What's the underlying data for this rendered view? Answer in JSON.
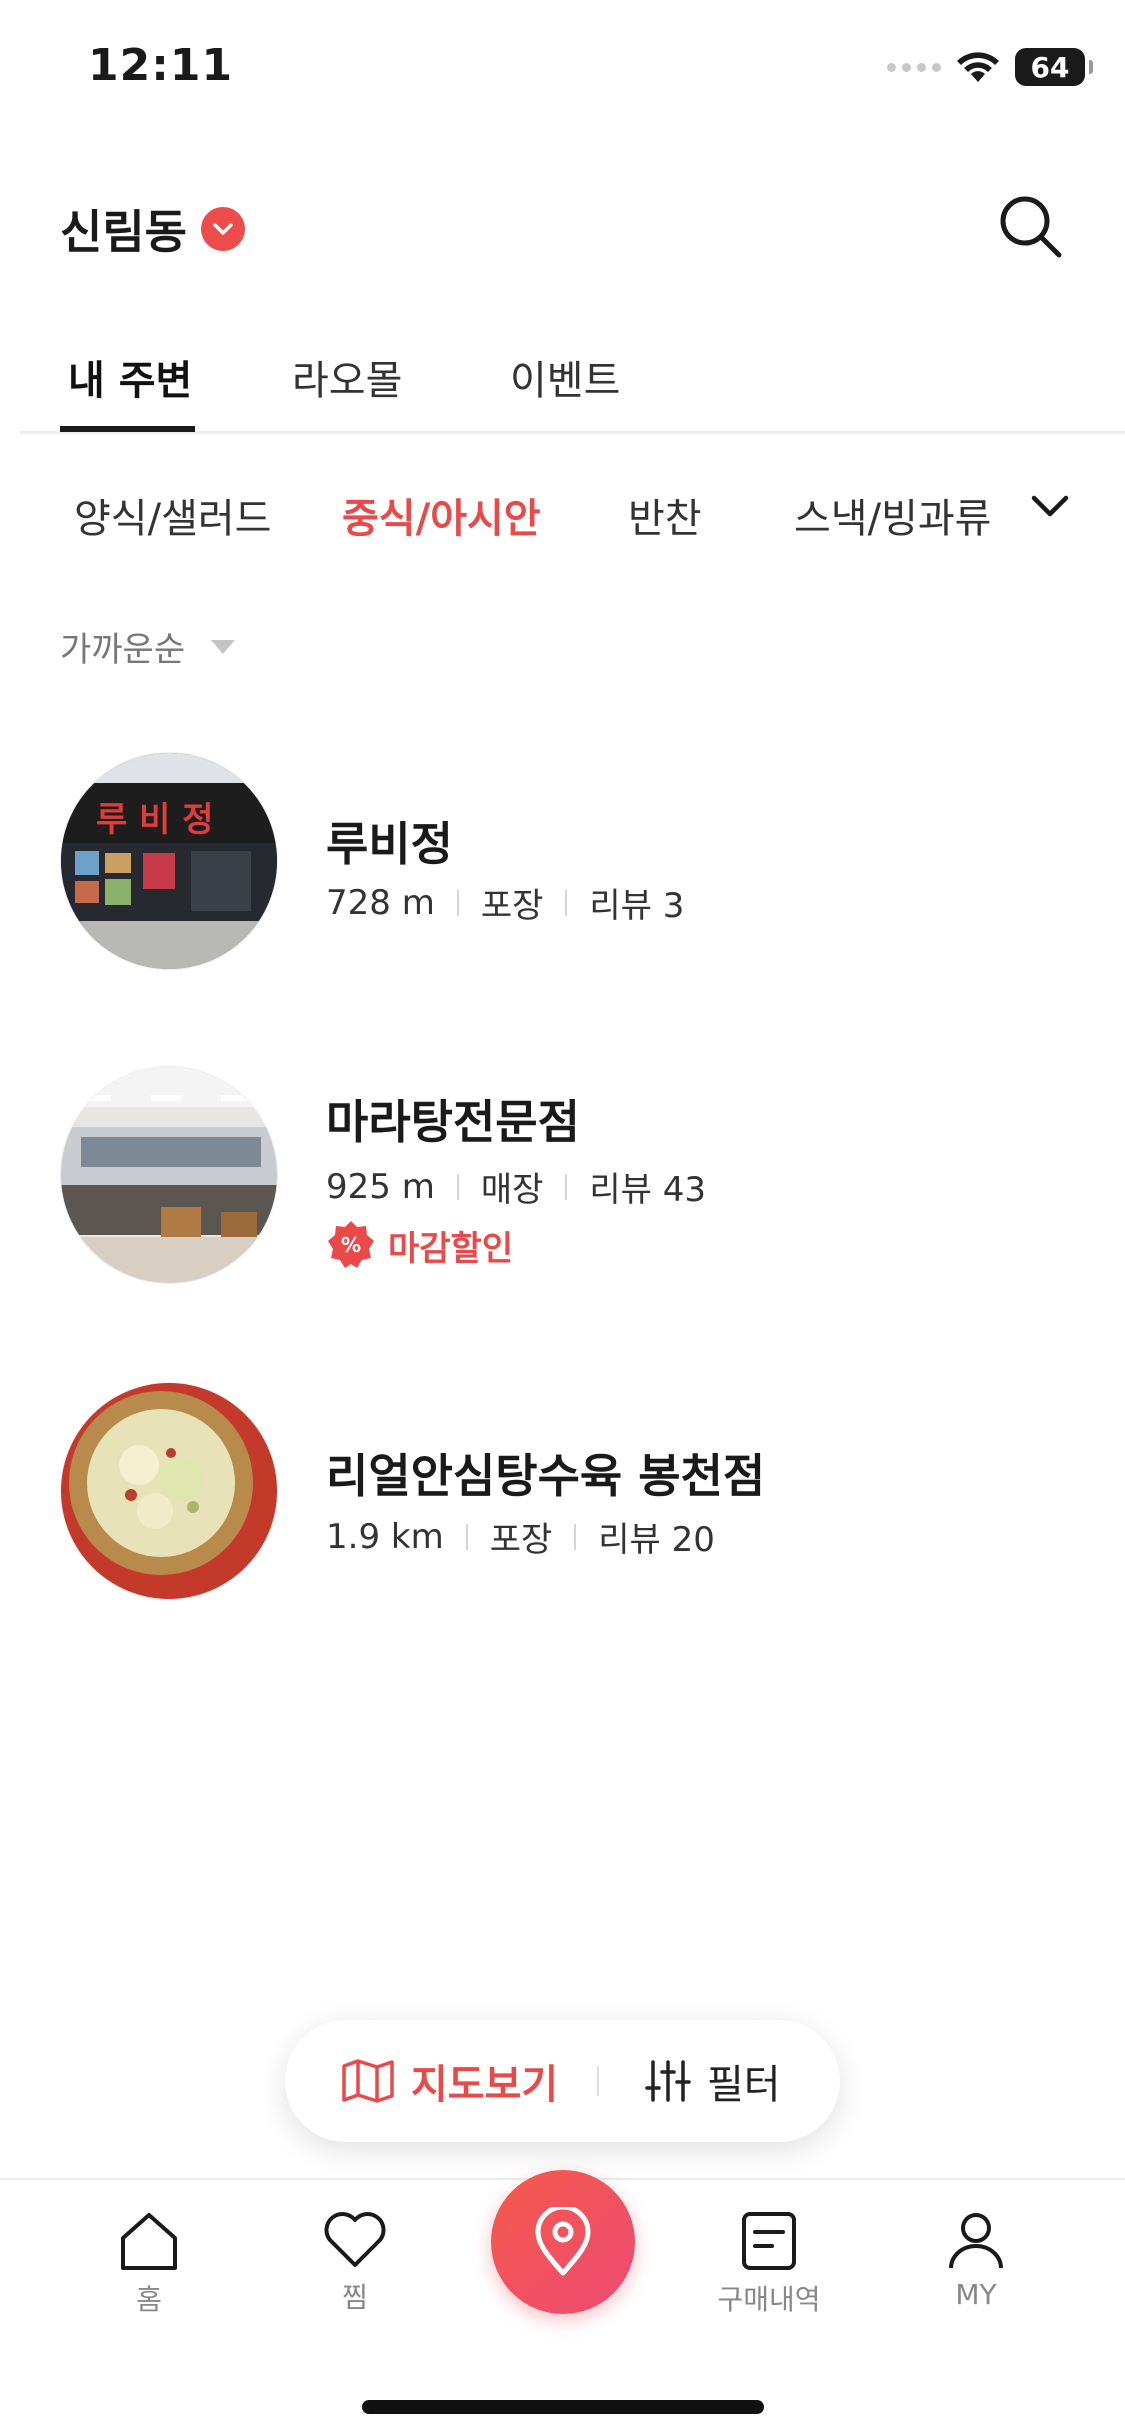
{
  "status_bar": {
    "time": "12:11",
    "battery": "64"
  },
  "header": {
    "location": "신림동"
  },
  "main_tabs": [
    {
      "label": "내 주변",
      "active": true
    },
    {
      "label": "라오몰",
      "active": false
    },
    {
      "label": "이벤트",
      "active": false
    }
  ],
  "categories": [
    {
      "label": "양식/샐러드",
      "active": false
    },
    {
      "label": "중식/아시안",
      "active": true
    },
    {
      "label": "반찬",
      "active": false
    },
    {
      "label": "스낵/빙과류",
      "active": false
    }
  ],
  "sort": {
    "label": "가까운순"
  },
  "stores": [
    {
      "name": "루비정",
      "distance": "728 m",
      "type": "포장",
      "reviews": "리뷰 3",
      "sign_text": "루 비 정"
    },
    {
      "name": "마라탕전문점",
      "distance": "925 m",
      "type": "매장",
      "reviews": "리뷰 43",
      "promo": "마감할인"
    },
    {
      "name": "리얼안심탕수육 봉천점",
      "distance": "1.9 km",
      "type": "포장",
      "reviews": "리뷰 20"
    }
  ],
  "floating": {
    "map_label": "지도보기",
    "filter_label": "필터"
  },
  "bottom_nav": {
    "home": "홈",
    "wishlist": "찜",
    "orders": "구매내역",
    "my": "MY"
  },
  "colors": {
    "accent": "#ea4949",
    "center_gradient": [
      "#f45a4a",
      "#ec4a73"
    ]
  }
}
